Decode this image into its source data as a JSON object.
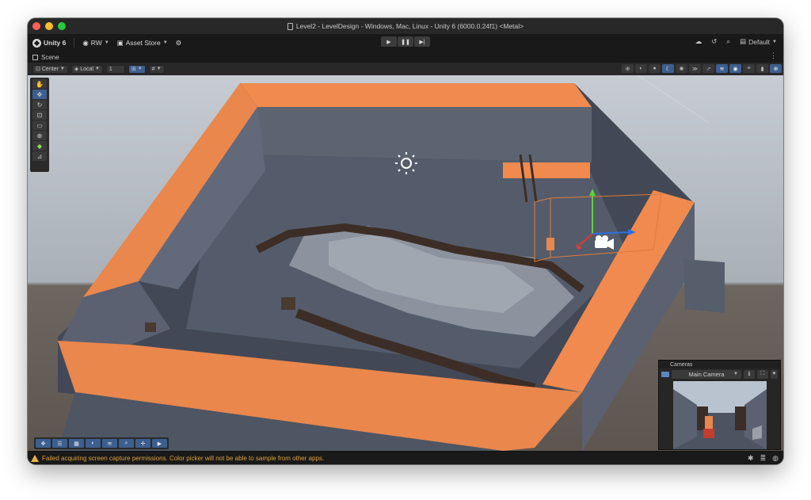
{
  "window": {
    "title": "Level2 - LevelDesign - Windows, Mac, Linux - Unity 6 (6000.0.24f1) <Metal>",
    "traffic_colors": [
      "#ff5f57",
      "#febc2e",
      "#28c840"
    ]
  },
  "toolbar": {
    "unity_label": "Unity 6",
    "account_label": "RW",
    "store_label": "Asset Store",
    "play_icons": [
      "play-icon",
      "pause-icon",
      "step-icon"
    ],
    "layout_label": "Default"
  },
  "tab": {
    "label": "Scene"
  },
  "scene_toolbar": {
    "pivot_label": "Center",
    "space_label": "Local",
    "grid_value": "1"
  },
  "tools": {
    "items": [
      "hand-icon",
      "move-icon",
      "rotate-icon",
      "scale-icon",
      "rect-icon",
      "transform-icon",
      "custom-tool-icon",
      "editor-tool-icon"
    ],
    "active": "move-icon"
  },
  "bottom_tools": [
    "move-icon",
    "settings-icon",
    "grid-icon",
    "light-icon",
    "layers-icon",
    "search-icon",
    "transform-icon",
    "camera-icon"
  ],
  "cameras_overlay": {
    "title": "Cameras",
    "selected_camera": "Main Camera"
  },
  "status": {
    "message": "Failed acquiring screen capture permissions. Color picker will not be able to sample from other apps."
  },
  "colors": {
    "accent": "#3d5f8f",
    "wall_top": "#e9874d",
    "floor": "#4e5563",
    "warning": "#e0a43c"
  }
}
